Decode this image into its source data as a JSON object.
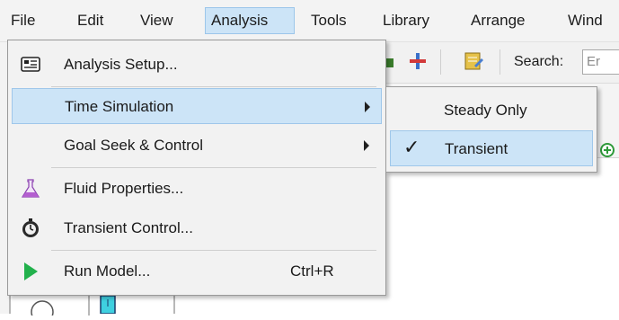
{
  "menubar": {
    "items": [
      {
        "label": "File"
      },
      {
        "label": "Edit"
      },
      {
        "label": "View"
      },
      {
        "label": "Analysis"
      },
      {
        "label": "Tools"
      },
      {
        "label": "Library"
      },
      {
        "label": "Arrange"
      },
      {
        "label": "Wind"
      }
    ]
  },
  "toolbar": {
    "search_label": "Search:",
    "search_placeholder": "Er"
  },
  "analysis_menu": {
    "items": [
      {
        "label": "Analysis Setup...",
        "icon": "analysis-setup-icon"
      },
      {
        "label": "Time Simulation",
        "submenu": true
      },
      {
        "label": "Goal Seek & Control",
        "submenu": true
      },
      {
        "label": "Fluid Properties...",
        "icon": "flask-icon"
      },
      {
        "label": "Transient Control...",
        "icon": "stopwatch-icon"
      },
      {
        "label": "Run Model...",
        "icon": "run-arrow-icon",
        "shortcut": "Ctrl+R"
      }
    ]
  },
  "time_simulation_submenu": {
    "items": [
      {
        "label": "Steady Only",
        "checked": false
      },
      {
        "label": "Transient",
        "checked": true,
        "check_mark": "✓"
      }
    ]
  },
  "colors": {
    "highlight": "#cce4f7",
    "highlight_border": "#9fc7ea",
    "run_green": "#22b14c",
    "flask_purple": "#b45fd0"
  }
}
